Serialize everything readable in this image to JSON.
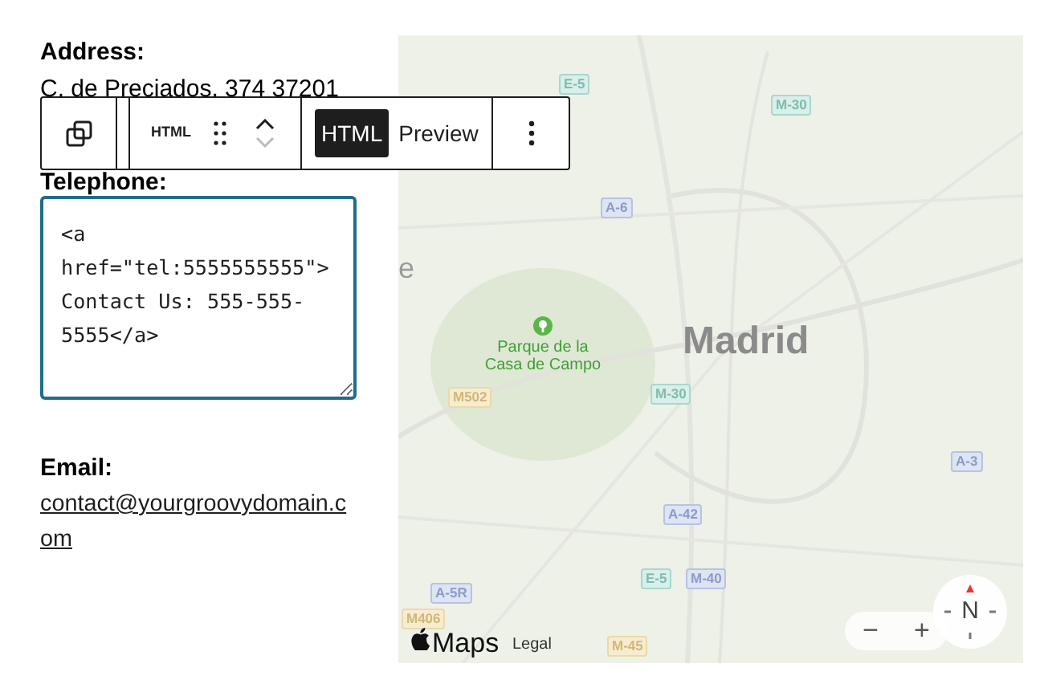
{
  "contact": {
    "address_label": "Address:",
    "address": "C. de Preciados, 374 37201",
    "telephone_label": "Telephone:",
    "html_code": "<a href=\"tel:5555555555\"> Contact Us: 555-555-5555</a>",
    "email_label": "Email:",
    "email": "contact@yourgroovydomain.com"
  },
  "toolbar": {
    "block_label": "HTML",
    "modes": [
      {
        "label": "HTML",
        "selected": true
      },
      {
        "label": "Preview",
        "selected": false
      }
    ]
  },
  "map": {
    "city": "Madrid",
    "park": "Parque de la Casa de Campo",
    "edge_label": "e",
    "shields": [
      {
        "text": "E-5",
        "kind": "european"
      },
      {
        "text": "M-30",
        "kind": "ring"
      },
      {
        "text": "A-6",
        "kind": "motorway"
      },
      {
        "text": "M502",
        "kind": "regional"
      },
      {
        "text": "M-30",
        "kind": "ring"
      },
      {
        "text": "A-3",
        "kind": "motorway"
      },
      {
        "text": "A-42",
        "kind": "motorway"
      },
      {
        "text": "E-5",
        "kind": "european"
      },
      {
        "text": "M-40",
        "kind": "motorway"
      },
      {
        "text": "A-5R",
        "kind": "motorway"
      },
      {
        "text": "M406",
        "kind": "regional"
      },
      {
        "text": "M-45",
        "kind": "regional"
      }
    ],
    "brand": "Maps",
    "legal": "Legal",
    "zoom_out": "−",
    "zoom_in": "+",
    "compass": "N"
  }
}
